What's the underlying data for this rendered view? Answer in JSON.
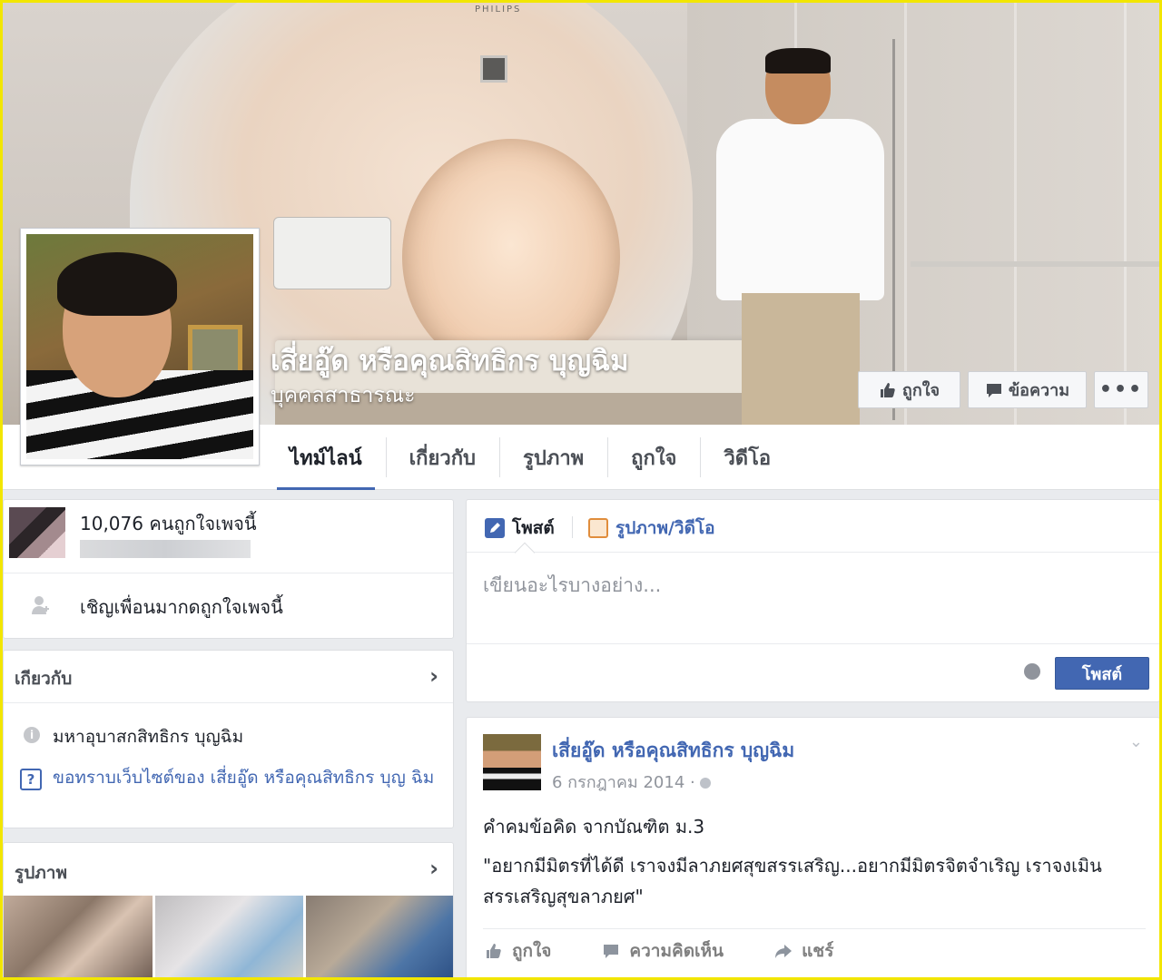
{
  "page": {
    "name": "เสี่ยอู๊ด หรือคุณสิทธิกร บุญฉิม",
    "category": "บุคคลสาธารณะ",
    "cover_brand": "PHILIPS"
  },
  "cover_buttons": {
    "like": "ถูกใจ",
    "message": "ข้อความ",
    "more": "•••"
  },
  "tabs": [
    {
      "label": "ไทม์ไลน์",
      "active": true
    },
    {
      "label": "เกี่ยวกับ",
      "active": false
    },
    {
      "label": "รูปภาพ",
      "active": false
    },
    {
      "label": "ถูกใจ",
      "active": false
    },
    {
      "label": "วิดีโอ",
      "active": false
    }
  ],
  "likes_box": {
    "count_text": "10,076 คนถูกใจเพจนี้",
    "invite_text": "เชิญเพื่อนมากดถูกใจเพจนี้"
  },
  "about_box": {
    "title": "เกียวกับ",
    "description": "มหาอุบาสกสิทธิกร บุญฉิม",
    "website_link": "ขอทราบเว็บไซต์ของ เสี่ยอู๊ด หรือคุณสิทธิกร บุญ ฉิม"
  },
  "photos_box": {
    "title": "รูปภาพ"
  },
  "composer": {
    "tab_post": "โพสต์",
    "tab_photo_video": "รูปภาพ/วิดีโอ",
    "placeholder": "เขียนอะไรบางอย่าง...",
    "post_button": "โพสต์"
  },
  "post": {
    "author": "เสี่ยอู๊ด หรือคุณสิทธิกร บุญฉิม",
    "date": "6 กรกฎาคม 2014 · ",
    "line1": "คำคมข้อคิด จากบัณฑิต ม.3",
    "line2": "\"อยากมีมิตรที่ได้ดี เราจงมีลาภยศสุขสรรเสริญ...อยากมีมิตรจิตจำเริญ เราจงเมินสรรเสริญสุขลาภยศ\"",
    "actions": {
      "like": "ถูกใจ",
      "comment": "ความคิดเห็น",
      "share": "แชร์"
    }
  },
  "colors": {
    "accent": "#4267b2",
    "frame": "#f2e600",
    "background": "#e9ebee"
  }
}
